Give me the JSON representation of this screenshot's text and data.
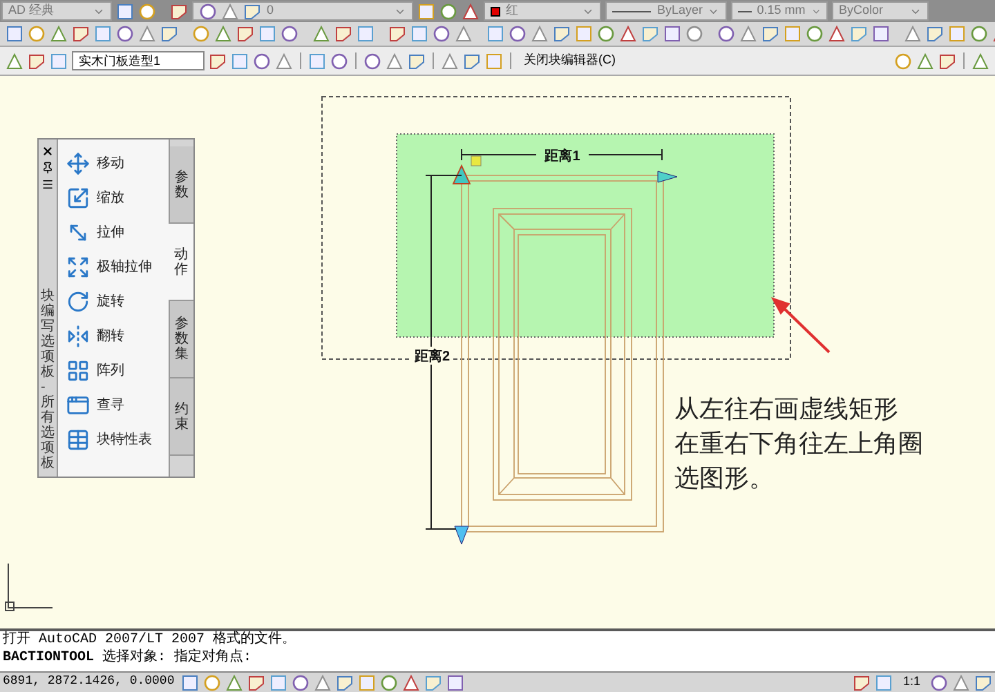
{
  "toolbar_top": {
    "workspace": "AD 经典",
    "layer": "0",
    "color_name": "红",
    "linetype": "ByLayer",
    "lineweight": "0.15 mm",
    "plotstyle": "ByColor"
  },
  "block_editor_toolbar": {
    "block_name": "实木门板造型1",
    "close_button": "关闭块编辑器(C)"
  },
  "palette": {
    "title": "块编写选项板 - 所有选项板",
    "items": [
      "移动",
      "缩放",
      "拉伸",
      "极轴拉伸",
      "旋转",
      "翻转",
      "阵列",
      "查寻",
      "块特性表"
    ],
    "tabs": [
      {
        "label": "参数",
        "selected": false
      },
      {
        "label": "动作",
        "selected": true
      },
      {
        "label": "参数集",
        "selected": false
      },
      {
        "label": "约束",
        "selected": false
      }
    ]
  },
  "drawing": {
    "dimension_1": "距离1",
    "dimension_2": "距离2",
    "annotation": [
      "从左往右画虚线矩形",
      "在重右下角往左上角圈",
      "选图形。"
    ]
  },
  "command_line": [
    "打开 AutoCAD 2007/LT 2007 格式的文件。",
    "**BACTIONTOOL** 选择对象: 指定对角点:"
  ],
  "status_bar": {
    "coordinates": "6891, 2872.1426, 0.0000",
    "scale": "1:1"
  }
}
